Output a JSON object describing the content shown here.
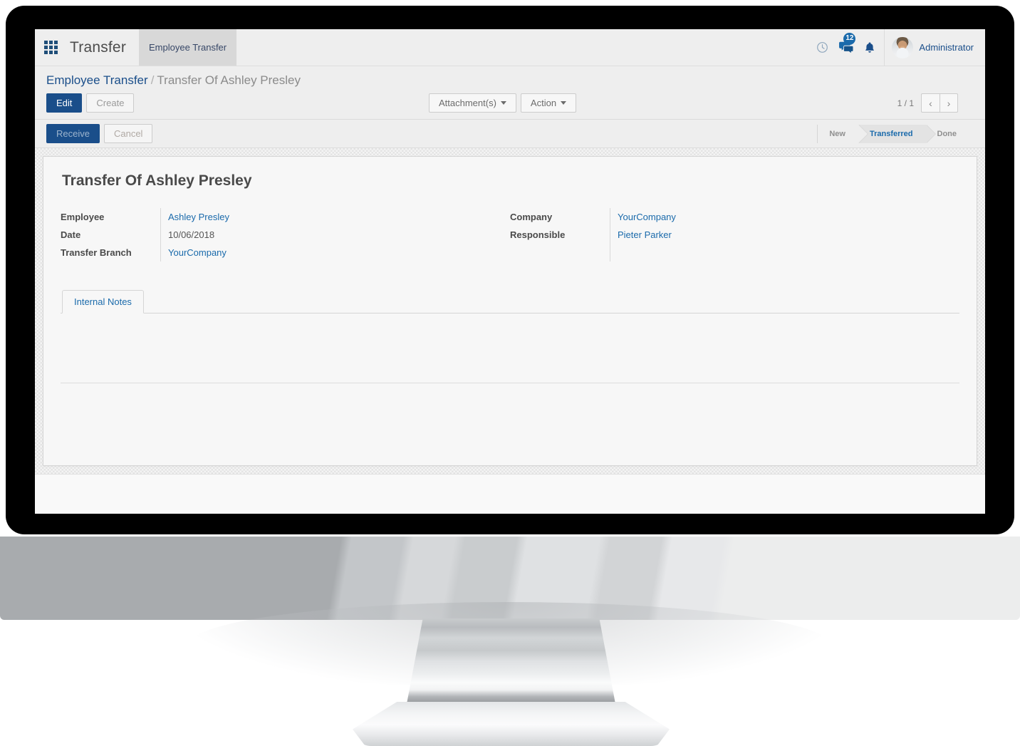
{
  "topbar": {
    "apps_icon": "apps-grid-icon",
    "app_title": "Transfer",
    "menu": [
      {
        "label": "Employee Transfer",
        "active": true
      }
    ],
    "sysicons": [
      {
        "name": "clock-icon",
        "glyph": "◴"
      },
      {
        "name": "messages-icon",
        "glyph": "⚇",
        "badge": "12"
      },
      {
        "name": "notification-bell-icon",
        "glyph": "🔔"
      }
    ],
    "user_name": "Administrator"
  },
  "breadcrumb": {
    "parent": "Employee Transfer",
    "separator": "/",
    "current": "Transfer Of Ashley Presley"
  },
  "control_bar": {
    "edit_label": "Edit",
    "create_label": "Create",
    "attachments_label": "Attachment(s)",
    "action_label": "Action",
    "pager_count": "1 / 1",
    "prev_glyph": "‹",
    "next_glyph": "›"
  },
  "status_line": {
    "receive_label": "Receive",
    "cancel_label": "Cancel",
    "statusbar": [
      {
        "label": "New",
        "active": false
      },
      {
        "label": "Transferred",
        "active": true
      },
      {
        "label": "Done",
        "active": false
      }
    ]
  },
  "form": {
    "title": "Transfer Of Ashley Presley",
    "left_fields": [
      {
        "label": "Employee",
        "value": "Ashley Presley",
        "link": true
      },
      {
        "label": "Date",
        "value": "10/06/2018",
        "link": false
      },
      {
        "label": "Transfer Branch",
        "value": "YourCompany",
        "link": true
      }
    ],
    "right_fields": [
      {
        "label": "Company",
        "value": "YourCompany",
        "link": true
      },
      {
        "label": "Responsible",
        "value": "Pieter Parker",
        "link": true
      }
    ],
    "tabs": [
      {
        "label": "Internal Notes",
        "active": true
      }
    ],
    "notes_value": ""
  },
  "colors": {
    "accent": "#1a4e8a",
    "link": "#1a6aab",
    "topbar_bg": "#eeeeee",
    "sheet_bg": "#f7f7f7"
  }
}
